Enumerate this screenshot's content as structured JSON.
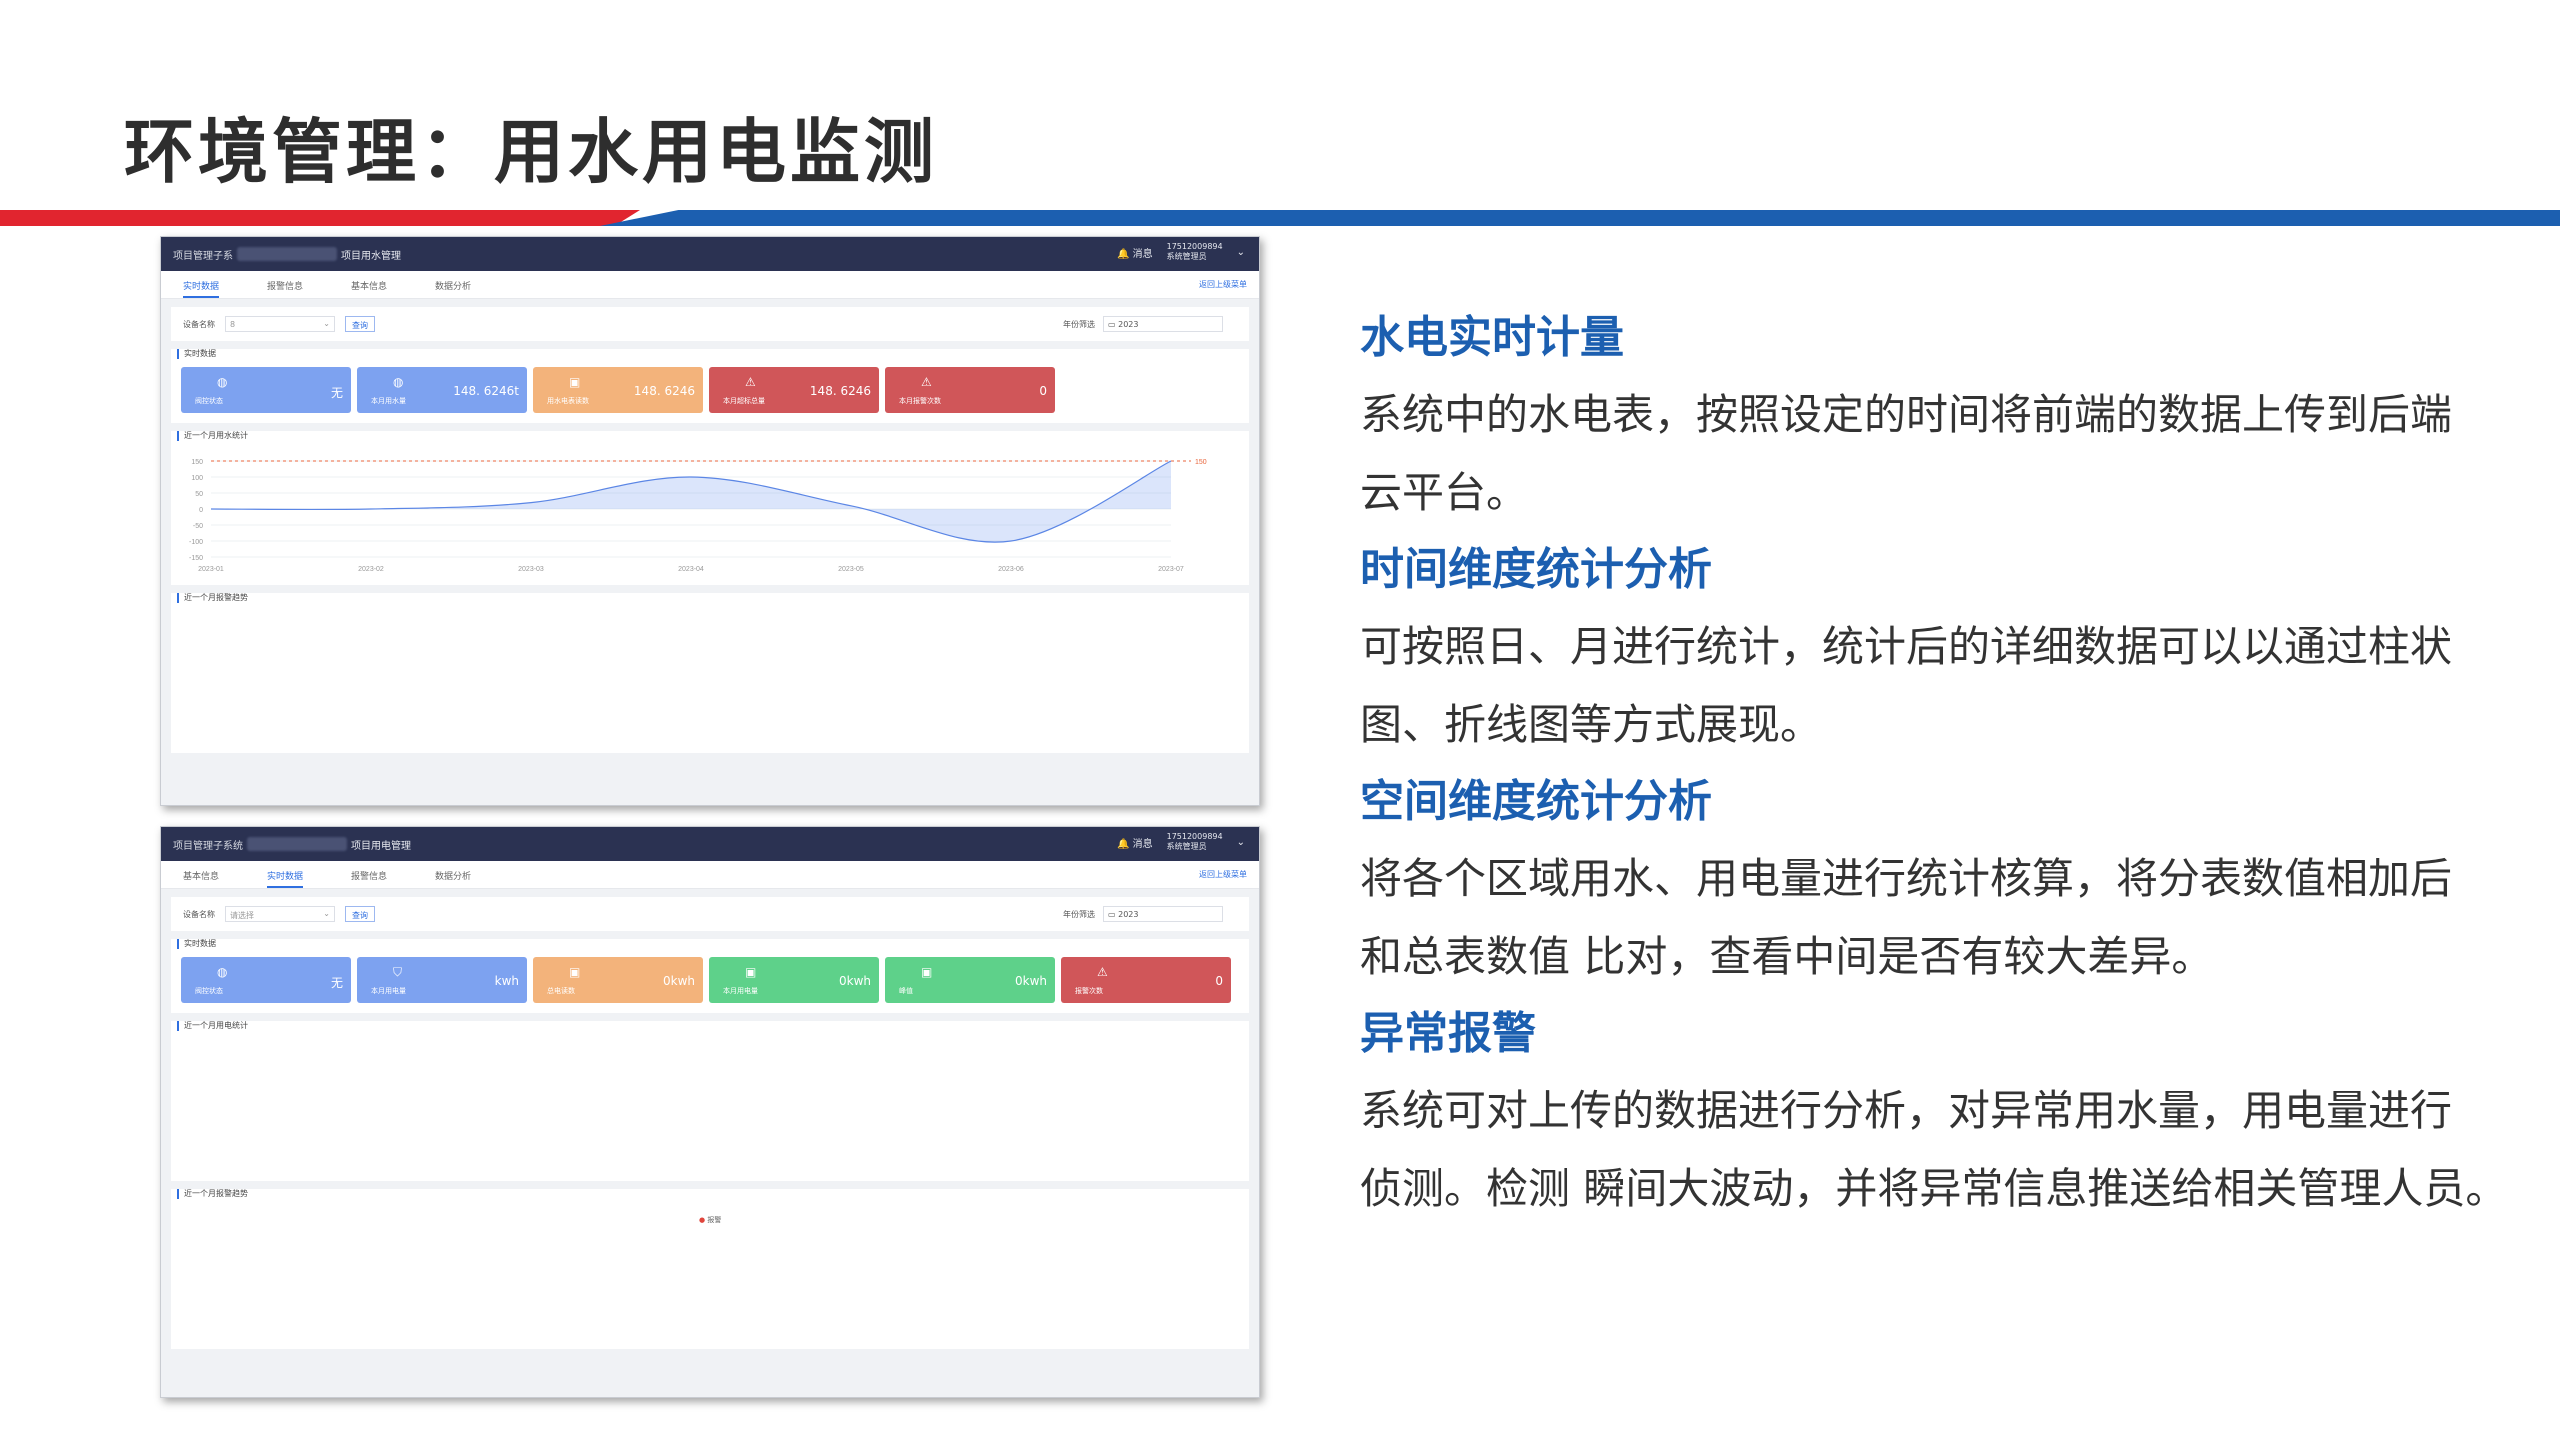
{
  "slide": {
    "title": "环境管理：用水用电监测"
  },
  "colors": {
    "accent_red": "#e1252f",
    "accent_blue": "#1c5fb0",
    "card_blue": "#7da2f0",
    "card_orange": "#f3b37b",
    "card_red": "#d05659",
    "card_green": "#5ed18a"
  },
  "water_app": {
    "system_name": "项目管理子系",
    "module_name": "项目用水管理",
    "bell_label": "消息",
    "user_phone": "17512009894",
    "user_role": "系统管理员",
    "tabs": [
      "实时数据",
      "报警信息",
      "基本信息",
      "数据分析"
    ],
    "active_tab": "实时数据",
    "back_link": "返回上级菜单",
    "device_label": "设备名称",
    "device_value": "8",
    "query_label": "查询",
    "year_label": "年份筛选",
    "year_value": "2023",
    "realtime_title": "实时数据",
    "cards": [
      {
        "icon": "valve-icon",
        "label": "阀控状态",
        "value": "无",
        "color": "blue"
      },
      {
        "icon": "water-drop-icon",
        "label": "本月用水量",
        "value": "148. 6246t",
        "color": "blue"
      },
      {
        "icon": "water-meter-icon",
        "label": "用水电表读数",
        "value": "148. 6246",
        "color": "orange"
      },
      {
        "icon": "warning-icon",
        "label": "本月超标总量",
        "value": "148. 6246",
        "color": "red"
      },
      {
        "icon": "warning-icon",
        "label": "本月报警次数",
        "value": "0",
        "color": "red"
      }
    ],
    "trend_title": "近一个月用水统计",
    "alarm_title": "近一个月报警趋势"
  },
  "chart_data": {
    "type": "area",
    "title": "近一个月用水统计",
    "x": [
      "2023-01",
      "2023-02",
      "2023-03",
      "2023-04",
      "2023-05",
      "2023-06",
      "2023-07"
    ],
    "series": [
      {
        "values": [
          0,
          0,
          20,
          100,
          10,
          -100,
          150
        ]
      }
    ],
    "y_ticks": [
      "150",
      "100",
      "50",
      "0",
      "-50",
      "-100",
      "-150"
    ],
    "ylim": [
      -150,
      150
    ],
    "markline": {
      "value": 150,
      "label": "150"
    }
  },
  "power_app": {
    "system_name": "项目管理子系统",
    "module_name": "项目用电管理",
    "bell_label": "消息",
    "user_phone": "17512009894",
    "user_role": "系统管理员",
    "tabs": [
      "基本信息",
      "实时数据",
      "报警信息",
      "数据分析"
    ],
    "active_tab": "实时数据",
    "back_link": "返回上级菜单",
    "device_label": "设备名称",
    "device_placeholder": "请选择",
    "query_label": "查询",
    "year_label": "年份筛选",
    "year_value": "2023",
    "realtime_title": "实时数据",
    "cards": [
      {
        "icon": "valve-icon",
        "label": "阀控状态",
        "value": "无",
        "color": "blue"
      },
      {
        "icon": "shield-icon",
        "label": "本月用电量",
        "value": "kwh",
        "color": "blue"
      },
      {
        "icon": "meter-icon",
        "label": "总电读数",
        "value": "0kwh",
        "color": "orange"
      },
      {
        "icon": "meter-icon",
        "label": "本月用电量",
        "value": "0kwh",
        "color": "green"
      },
      {
        "icon": "meter-icon",
        "label": "峰值",
        "value": "0kwh",
        "color": "green"
      },
      {
        "icon": "warning-icon",
        "label": "报警次数",
        "value": "0",
        "color": "red"
      }
    ],
    "trend_title": "近一个月用电统计",
    "alarm_title": "近一个月报警趋势",
    "alarm_legend": "报警"
  },
  "features": [
    {
      "heading": "水电实时计量",
      "lines": [
        "系统中的水电表，按照设定的时间将前端的数据上传到后端",
        "云平台。"
      ]
    },
    {
      "heading": "时间维度统计分析",
      "lines": [
        "可按照日、月进行统计，统计后的详细数据可以以通过柱状",
        "图、折线图等方式展现。"
      ]
    },
    {
      "heading": "空间维度统计分析",
      "lines": [
        "将各个区域用水、用电量进行统计核算，将分表数值相加后",
        "和总表数值 比对，查看中间是否有较大差异。"
      ]
    },
    {
      "heading": "异常报警",
      "lines": [
        "系统可对上传的数据进行分析，对异常用水量，用电量进行",
        "侦测。检测 瞬间大波动，并将异常信息推送给相关管理人员。"
      ]
    }
  ]
}
